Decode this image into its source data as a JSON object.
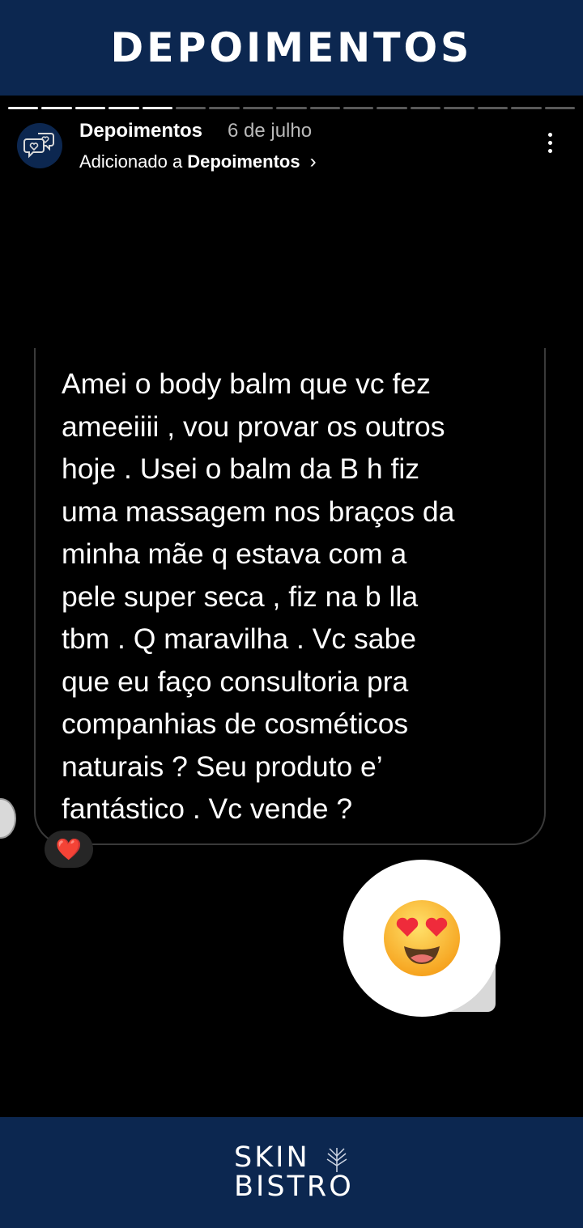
{
  "banner": {
    "title": "DEPOIMENTOS"
  },
  "story": {
    "progress": {
      "total_segments": 17,
      "completed_segments": 5
    },
    "header": {
      "account_name": "Depoimentos",
      "date": "6 de julho",
      "added_prefix": "Adicionado a",
      "highlight_name": "Depoimentos",
      "chevron": "›"
    },
    "message": {
      "lines": [
        "Amei o body balm que vc fez",
        "ameeiiii , vou provar os outros",
        "hoje . Usei o balm da B   h fiz",
        "uma massagem nos braços da",
        "minha mãe q estava com a",
        "pele super seca , fiz na b   lla",
        "tbm . Q maravilha . Vc sabe",
        "que eu faço consultoria pra",
        "companhias de cosméticos",
        "naturais ? Seu produto e’",
        "fantástico . Vc vende ?"
      ],
      "reaction": "❤️"
    },
    "sticker_emoji": "😍"
  },
  "footer": {
    "brand_line1": "SKIN",
    "brand_line2": "BISTRO"
  },
  "colors": {
    "navy": "#0c2750",
    "story_bg": "#000000",
    "heart": "#e0203a",
    "sticker_bg": "#ffffff"
  }
}
